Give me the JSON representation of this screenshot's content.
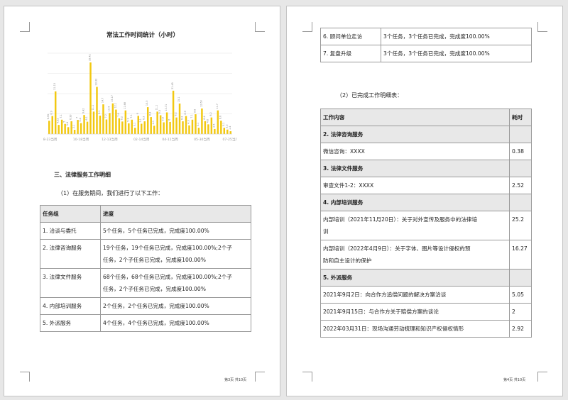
{
  "left_page": {
    "chart_title": "常法工作时间统计（小时）",
    "section_heading": "三、法律服务工作明细",
    "intro_text": "（1）在服务期间，我们进行了以下工作：",
    "summary_table": {
      "headers": [
        "任务组",
        "进度"
      ],
      "rows": [
        {
          "group": "1. 洽谈与委托",
          "progress": [
            "5个任务，5个任务已完成，完成度100.00%"
          ]
        },
        {
          "group": "2. 法律咨询服务",
          "progress": [
            "19个任务，19个任务已完成，完成度100.00%;2个子",
            "任务，2个子任务已完成，完成度100.00%"
          ]
        },
        {
          "group": "3. 法律文件服务",
          "progress": [
            "68个任务，68个任务已完成，完成度100.00%;2个子",
            "任务，2个子任务已完成，完成度100.00%"
          ]
        },
        {
          "group": "4. 内部培训服务",
          "progress": [
            "2个任务，2个任务已完成，完成度100.00%"
          ]
        },
        {
          "group": "5. 外派服务",
          "progress": [
            "4个任务，4个任务已完成，完成度100.00%"
          ]
        }
      ]
    },
    "footer": "第3页 共10页"
  },
  "right_page": {
    "top_table_rows": [
      {
        "group": "6. 顾问单位走访",
        "progress": "3个任务，3个任务已完成，完成度100.00%"
      },
      {
        "group": "7. 复盘升级",
        "progress": "3个任务，3个任务已完成，完成度100.00%"
      }
    ],
    "detail_heading": "（2）已完成工作明细表：",
    "detail_table": {
      "headers": [
        "工作内容",
        "耗时"
      ],
      "rows": [
        {
          "kind": "section",
          "content": [
            "2. 法律咨询服务"
          ],
          "hours": ""
        },
        {
          "kind": "item",
          "content": [
            "微信咨询：XXXX"
          ],
          "hours": "0.38"
        },
        {
          "kind": "section",
          "content": [
            "3. 法律文件服务"
          ],
          "hours": ""
        },
        {
          "kind": "item",
          "content": [
            "审查文件1-2：XXXX"
          ],
          "hours": "2.52"
        },
        {
          "kind": "section",
          "content": [
            "4. 内部培训服务"
          ],
          "hours": ""
        },
        {
          "kind": "item",
          "content": [
            "内部培训（2021年11月20日）：关于对外宣传及服务中的法律培",
            "训"
          ],
          "hours": "25.2"
        },
        {
          "kind": "item",
          "content": [
            "内部培训（2022年4月9日）：关于字体、图片等设计侵权的预",
            "防和自主设计的保护"
          ],
          "hours": "16.27"
        },
        {
          "kind": "section",
          "content": [
            "5. 外派服务"
          ],
          "hours": ""
        },
        {
          "kind": "item",
          "content": [
            "2021年9月2日：向合作方追偿问题的解决方案洽谈"
          ],
          "hours": "5.05"
        },
        {
          "kind": "item",
          "content": [
            "2021年9月15日：与合作方关于赔偿方案的谈论"
          ],
          "hours": "2"
        },
        {
          "kind": "item",
          "content": [
            "2022年03月31日：现场沟通劳动梳理和知识产权侵权情形"
          ],
          "hours": "2.92"
        }
      ]
    },
    "footer": "第4页 共10页"
  },
  "chart_data": {
    "type": "bar",
    "title": "常法工作时间统计（小时）",
    "bar_color": "#f2c811",
    "ylim": [
      0,
      40
    ],
    "grid": true,
    "x_tick_labels": [
      "08-23当周",
      "10-18当周",
      "12-13当周",
      "02-14当周",
      "04-11当周",
      "05-30当周",
      "07-25当周"
    ],
    "values": [
      6.55,
      8.9,
      21.13,
      4.52,
      7.1,
      5.0,
      3.4,
      6.33,
      2.1,
      7.0,
      5.4,
      9.42,
      6.1,
      35.42,
      11.1,
      23.33,
      9.1,
      14.7,
      7.2,
      10.4,
      15.17,
      12.1,
      7.8,
      6.2,
      11.68,
      5.3,
      7.1,
      3.1,
      9.0,
      5.1,
      6.3,
      13.3,
      8.4,
      4.1,
      11.1,
      9.3,
      5.8,
      10.71,
      6.0,
      21.45,
      8.2,
      15.1,
      6.3,
      8.9,
      4.3,
      7.1,
      9.8,
      3.1,
      12.63,
      6.4,
      4.8,
      8.2,
      2.5,
      11.7,
      6.6,
      3.1,
      2.2,
      1.4
    ]
  }
}
